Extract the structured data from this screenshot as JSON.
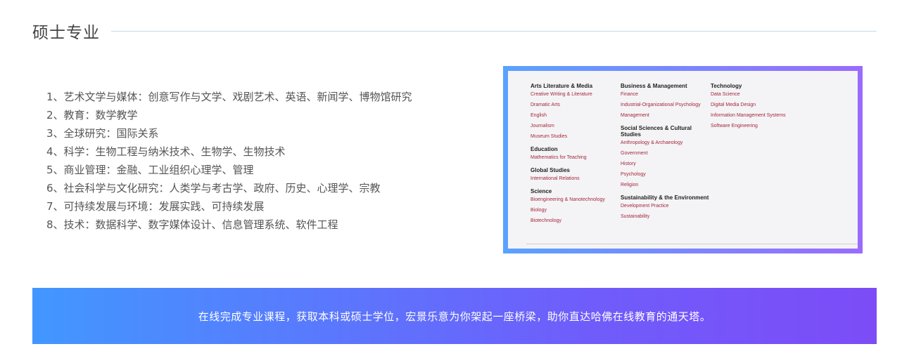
{
  "section": {
    "title": "硕士专业"
  },
  "programs": [
    "1、艺术文学与媒体：创意写作与文学、戏剧艺术、英语、新闻学、博物馆研究",
    "2、教育：数学教学",
    "3、全球研究：国际关系",
    "4、科学：生物工程与纳米技术、生物学、生物技术",
    "5、商业管理：金融、工业组织心理学、管理",
    "6、社会科学与文化研究：人类学与考古学、政府、历史、心理学、宗教",
    "7、可持续发展与环境：发展实践、可持续发展",
    "8、技术：数据科学、数字媒体设计、信息管理系统、软件工程"
  ],
  "image": {
    "columns": [
      [
        {
          "heading": "Arts Literature & Media",
          "items": [
            "Creative Writing & Literature",
            "Dramatic Arts",
            "English",
            "Journalism",
            "Museum Studies"
          ]
        },
        {
          "heading": "Education",
          "items": [
            "Mathematics for Teaching"
          ]
        },
        {
          "heading": "Global Studies",
          "items": [
            "International Relations"
          ]
        },
        {
          "heading": "Science",
          "items": [
            "Bioengineering & Nanotechnology",
            "Biology",
            "Biotechnology"
          ]
        }
      ],
      [
        {
          "heading": "Business & Management",
          "items": [
            "Finance",
            "Industrial-Organizational Psychology",
            "Management"
          ]
        },
        {
          "heading": "Social Sciences & Cultural Studies",
          "items": [
            "Anthropology & Archaeology",
            "Government",
            "History",
            "Psychology",
            "Religion"
          ]
        },
        {
          "heading": "Sustainability & the Environment",
          "items": [
            "Development Practice",
            "Sustainability"
          ]
        }
      ],
      [
        {
          "heading": "Technology",
          "items": [
            "Data Science",
            "Digital Media Design",
            "Information Management Systems",
            "Software Engineering"
          ]
        }
      ]
    ]
  },
  "banner": {
    "text": "在线完成专业课程，获取本科或硕士学位，宏景乐意为你架起一座桥梁，助你直达哈佛在线教育的通天塔。"
  },
  "colors": {
    "title_text": "#444444",
    "rule": "#c9d9ec",
    "list_text": "#555555",
    "frame_start": "#5aa2ff",
    "frame_end": "#9a6bff",
    "link_red": "#a3273c",
    "banner_start": "#4297ff",
    "banner_end": "#7c4cf7"
  }
}
